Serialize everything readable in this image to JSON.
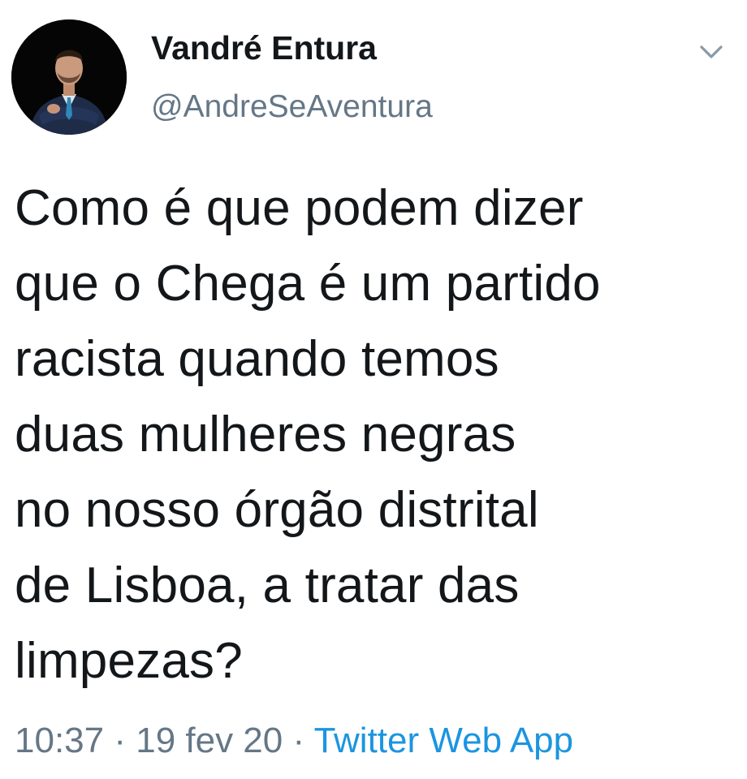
{
  "tweet": {
    "author": {
      "display_name": "Vandré Entura",
      "handle": "@AndreSeAventura"
    },
    "text_lines": [
      "Como é que podem dizer",
      "que o Chega é um partido",
      "racista quando temos",
      "duas mulheres negras",
      "no nosso órgão distrital",
      "de Lisboa, a tratar das",
      "limpezas?"
    ],
    "meta": {
      "time": "10:37",
      "separator": " · ",
      "date": "19 fev 20",
      "source_app": "Twitter Web App"
    },
    "icons": {
      "avatar": "profile-photo",
      "menu": "chevron-down-icon"
    },
    "colors": {
      "text": "#14171a",
      "secondary": "#657786",
      "link": "#1b95e0"
    }
  }
}
